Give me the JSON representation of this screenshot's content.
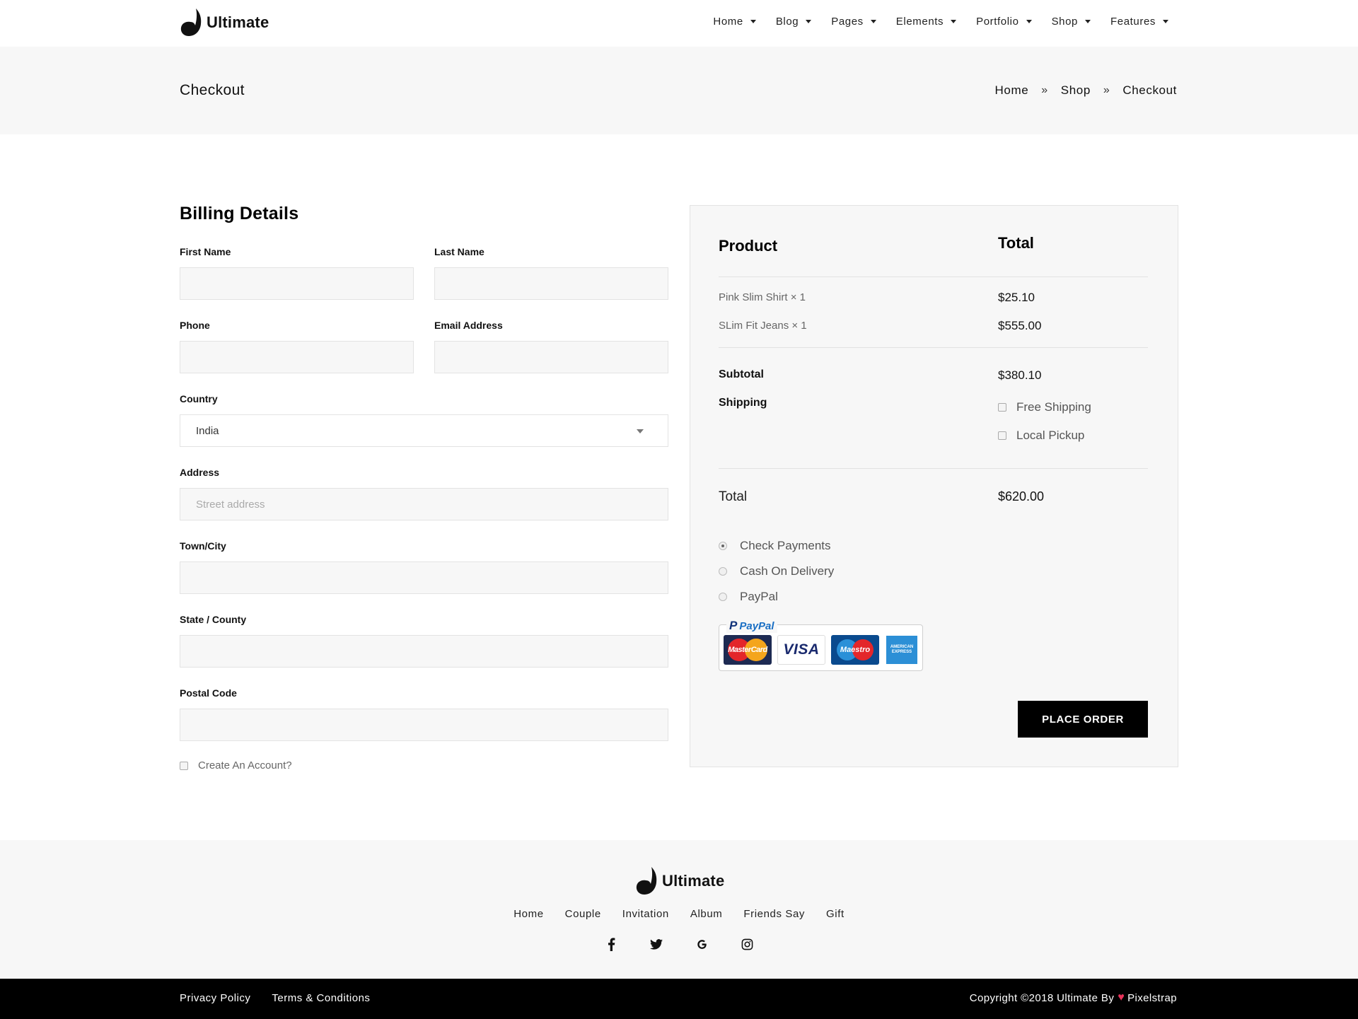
{
  "brand": {
    "name": "Ultimate",
    "accent": "#000000",
    "bg_band": "#f7f7f7"
  },
  "nav": [
    {
      "label": "Home"
    },
    {
      "label": "Blog"
    },
    {
      "label": "Pages"
    },
    {
      "label": "Elements"
    },
    {
      "label": "Portfolio"
    },
    {
      "label": "Shop"
    },
    {
      "label": "Features"
    }
  ],
  "page": {
    "title": "Checkout",
    "breadcrumb": [
      "Home",
      "Shop",
      "Checkout"
    ]
  },
  "billing": {
    "heading": "Billing Details",
    "first_name": {
      "label": "First Name",
      "value": ""
    },
    "last_name": {
      "label": "Last Name",
      "value": ""
    },
    "phone": {
      "label": "Phone",
      "value": ""
    },
    "email": {
      "label": "Email Address",
      "value": ""
    },
    "country": {
      "label": "Country",
      "value": "India"
    },
    "address": {
      "label": "Address",
      "placeholder": "Street address"
    },
    "city": {
      "label": "Town/City",
      "value": ""
    },
    "state": {
      "label": "State / County",
      "value": ""
    },
    "postal": {
      "label": "Postal Code",
      "value": ""
    },
    "create_account": {
      "label": "Create An Account?",
      "checked": false
    }
  },
  "order": {
    "product_header": "Product",
    "total_header": "Total",
    "items": [
      {
        "name": "Pink Slim Shirt × 1",
        "price": "$25.10"
      },
      {
        "name": "SLim Fit Jeans × 1",
        "price": "$555.00"
      }
    ],
    "subtotal_label": "Subtotal",
    "subtotal_value": "$380.10",
    "shipping_label": "Shipping",
    "shipping_options": [
      {
        "label": "Free Shipping",
        "checked": false
      },
      {
        "label": "Local Pickup",
        "checked": false
      }
    ],
    "total_label": "Total",
    "total_value": "$620.00",
    "payment_options": [
      {
        "label": "Check Payments",
        "selected": true
      },
      {
        "label": "Cash On Delivery",
        "selected": false
      },
      {
        "label": "PayPal",
        "selected": false
      }
    ],
    "cards": {
      "paypal": "PayPal",
      "mastercard": "MasterCard",
      "visa": "VISA",
      "maestro": "Maestro",
      "amex": "AMERICAN EXPRESS"
    },
    "place_order": "PLACE ORDER"
  },
  "footer": {
    "nav": [
      "Home",
      "Couple",
      "Invitation",
      "Album",
      "Friends Say",
      "Gift"
    ],
    "socials": [
      "facebook-icon",
      "twitter-icon",
      "google-icon",
      "instagram-icon"
    ],
    "links": [
      "Privacy Policy",
      "Terms & Conditions"
    ],
    "copyright_prefix": "Copyright ©2018 Ultimate By",
    "copyright_suffix": "Pixelstrap"
  }
}
